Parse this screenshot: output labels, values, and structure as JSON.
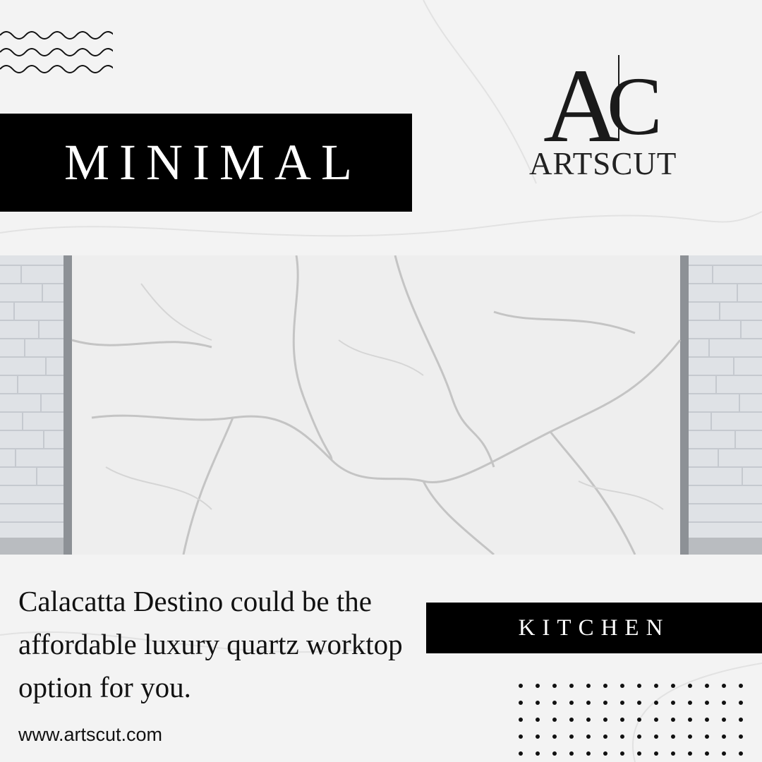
{
  "brand": {
    "monogram": "AC",
    "name": "ARTSCUT"
  },
  "headline": "MINIMAL",
  "description": "Calacatta Destino could be the affordable luxury quartz worktop option for you.",
  "category": "KITCHEN",
  "website": "www.artscut.com",
  "colors": {
    "background": "#f3f3f3",
    "bar": "#000000",
    "text": "#111111"
  },
  "icons": [
    "wave-lines-icon",
    "dot-grid-icon"
  ]
}
